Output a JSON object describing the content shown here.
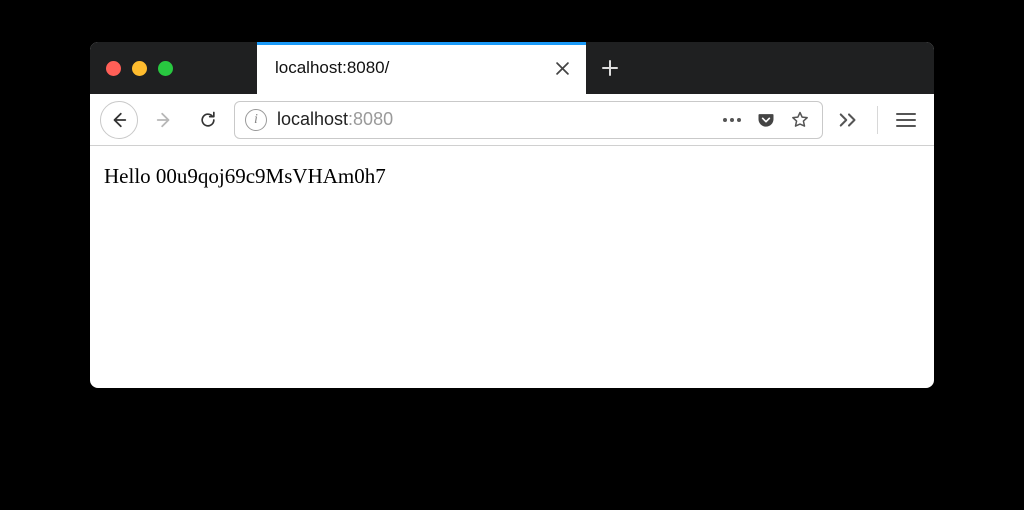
{
  "tabs": {
    "active_title": "localhost:8080/",
    "accent_color": "#1a9af8"
  },
  "address": {
    "info_label": "i",
    "host": "localhost",
    "port": ":8080"
  },
  "page": {
    "body_text": "Hello 00u9qoj69c9MsVHAm0h7"
  }
}
